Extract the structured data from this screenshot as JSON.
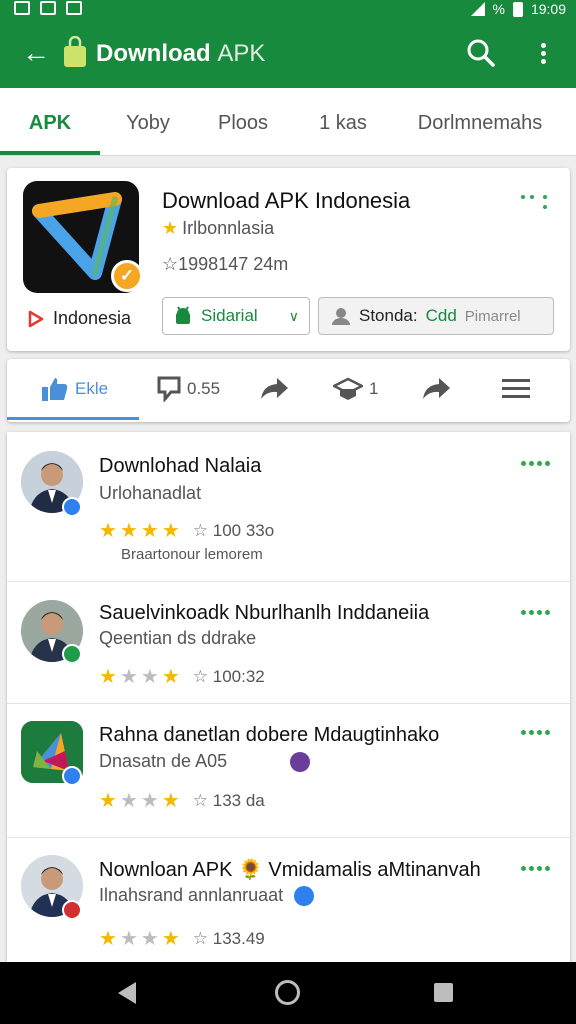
{
  "status_bar": {
    "time": "19:09",
    "battery": "%"
  },
  "app_bar": {
    "title": "Download",
    "title_suffix": "APK",
    "bg_color": "#178a3e"
  },
  "tabs": [
    {
      "label": "APK",
      "active": true
    },
    {
      "label": "Yoby"
    },
    {
      "label": "Ploos"
    },
    {
      "label": "1 kas"
    },
    {
      "label": "Dorlmnemahs"
    }
  ],
  "app_card": {
    "name": "Download APK Indonesia",
    "developer": "Irlbonnlasia",
    "meta": "☆1998147 24m",
    "publisher": "Indonesia",
    "install_label": "Sidarial",
    "wishlist_label": "Stonda:",
    "wishlist_green": "Cdd",
    "wishlist_grey": "Pimarrel"
  },
  "actions": [
    {
      "label": "Ekle",
      "icon": "thumbs-up-icon"
    },
    {
      "label": "0.55",
      "icon": "comment-icon"
    },
    {
      "label": "",
      "icon": "share-icon"
    },
    {
      "label": "1",
      "icon": "graduation-cap-icon"
    },
    {
      "label": "",
      "icon": "forward-icon"
    },
    {
      "label": "",
      "icon": "menu-icon"
    }
  ],
  "list": [
    {
      "title": "Downlohad Nalaia",
      "subtitle": "Urlohanadlat",
      "stars_on": 4,
      "rating": "100 33o",
      "note": "Braartonour lemorem",
      "badge_color": "#2f80ed"
    },
    {
      "title": "Sauelvinkoadk Nburlhanlh Inddaneiia",
      "subtitle": "Qeentian ds ddrake",
      "stars_on": [
        1,
        4
      ],
      "rating": "100:32",
      "note": "",
      "badge_color": "#1e9c4a"
    },
    {
      "title": "Rahna danetlan dobere Mdaugtinhako",
      "subtitle": "Dnasatn de A05",
      "stars_on": [
        1,
        4
      ],
      "rating": "133 da",
      "note": "",
      "badge_color": "#2f80ed"
    },
    {
      "title": "Nownloan APK 🌻 Vmidamalis aMtinanvah",
      "subtitle": "Ilnahsrand annlanruaat",
      "stars_on": [
        1,
        4
      ],
      "rating": "133.49",
      "note": "",
      "badge_color": "#d32f2f"
    }
  ],
  "colors": {
    "primary": "#178a3e",
    "star": "#f5b800",
    "accent_blue": "#4a90d9"
  }
}
